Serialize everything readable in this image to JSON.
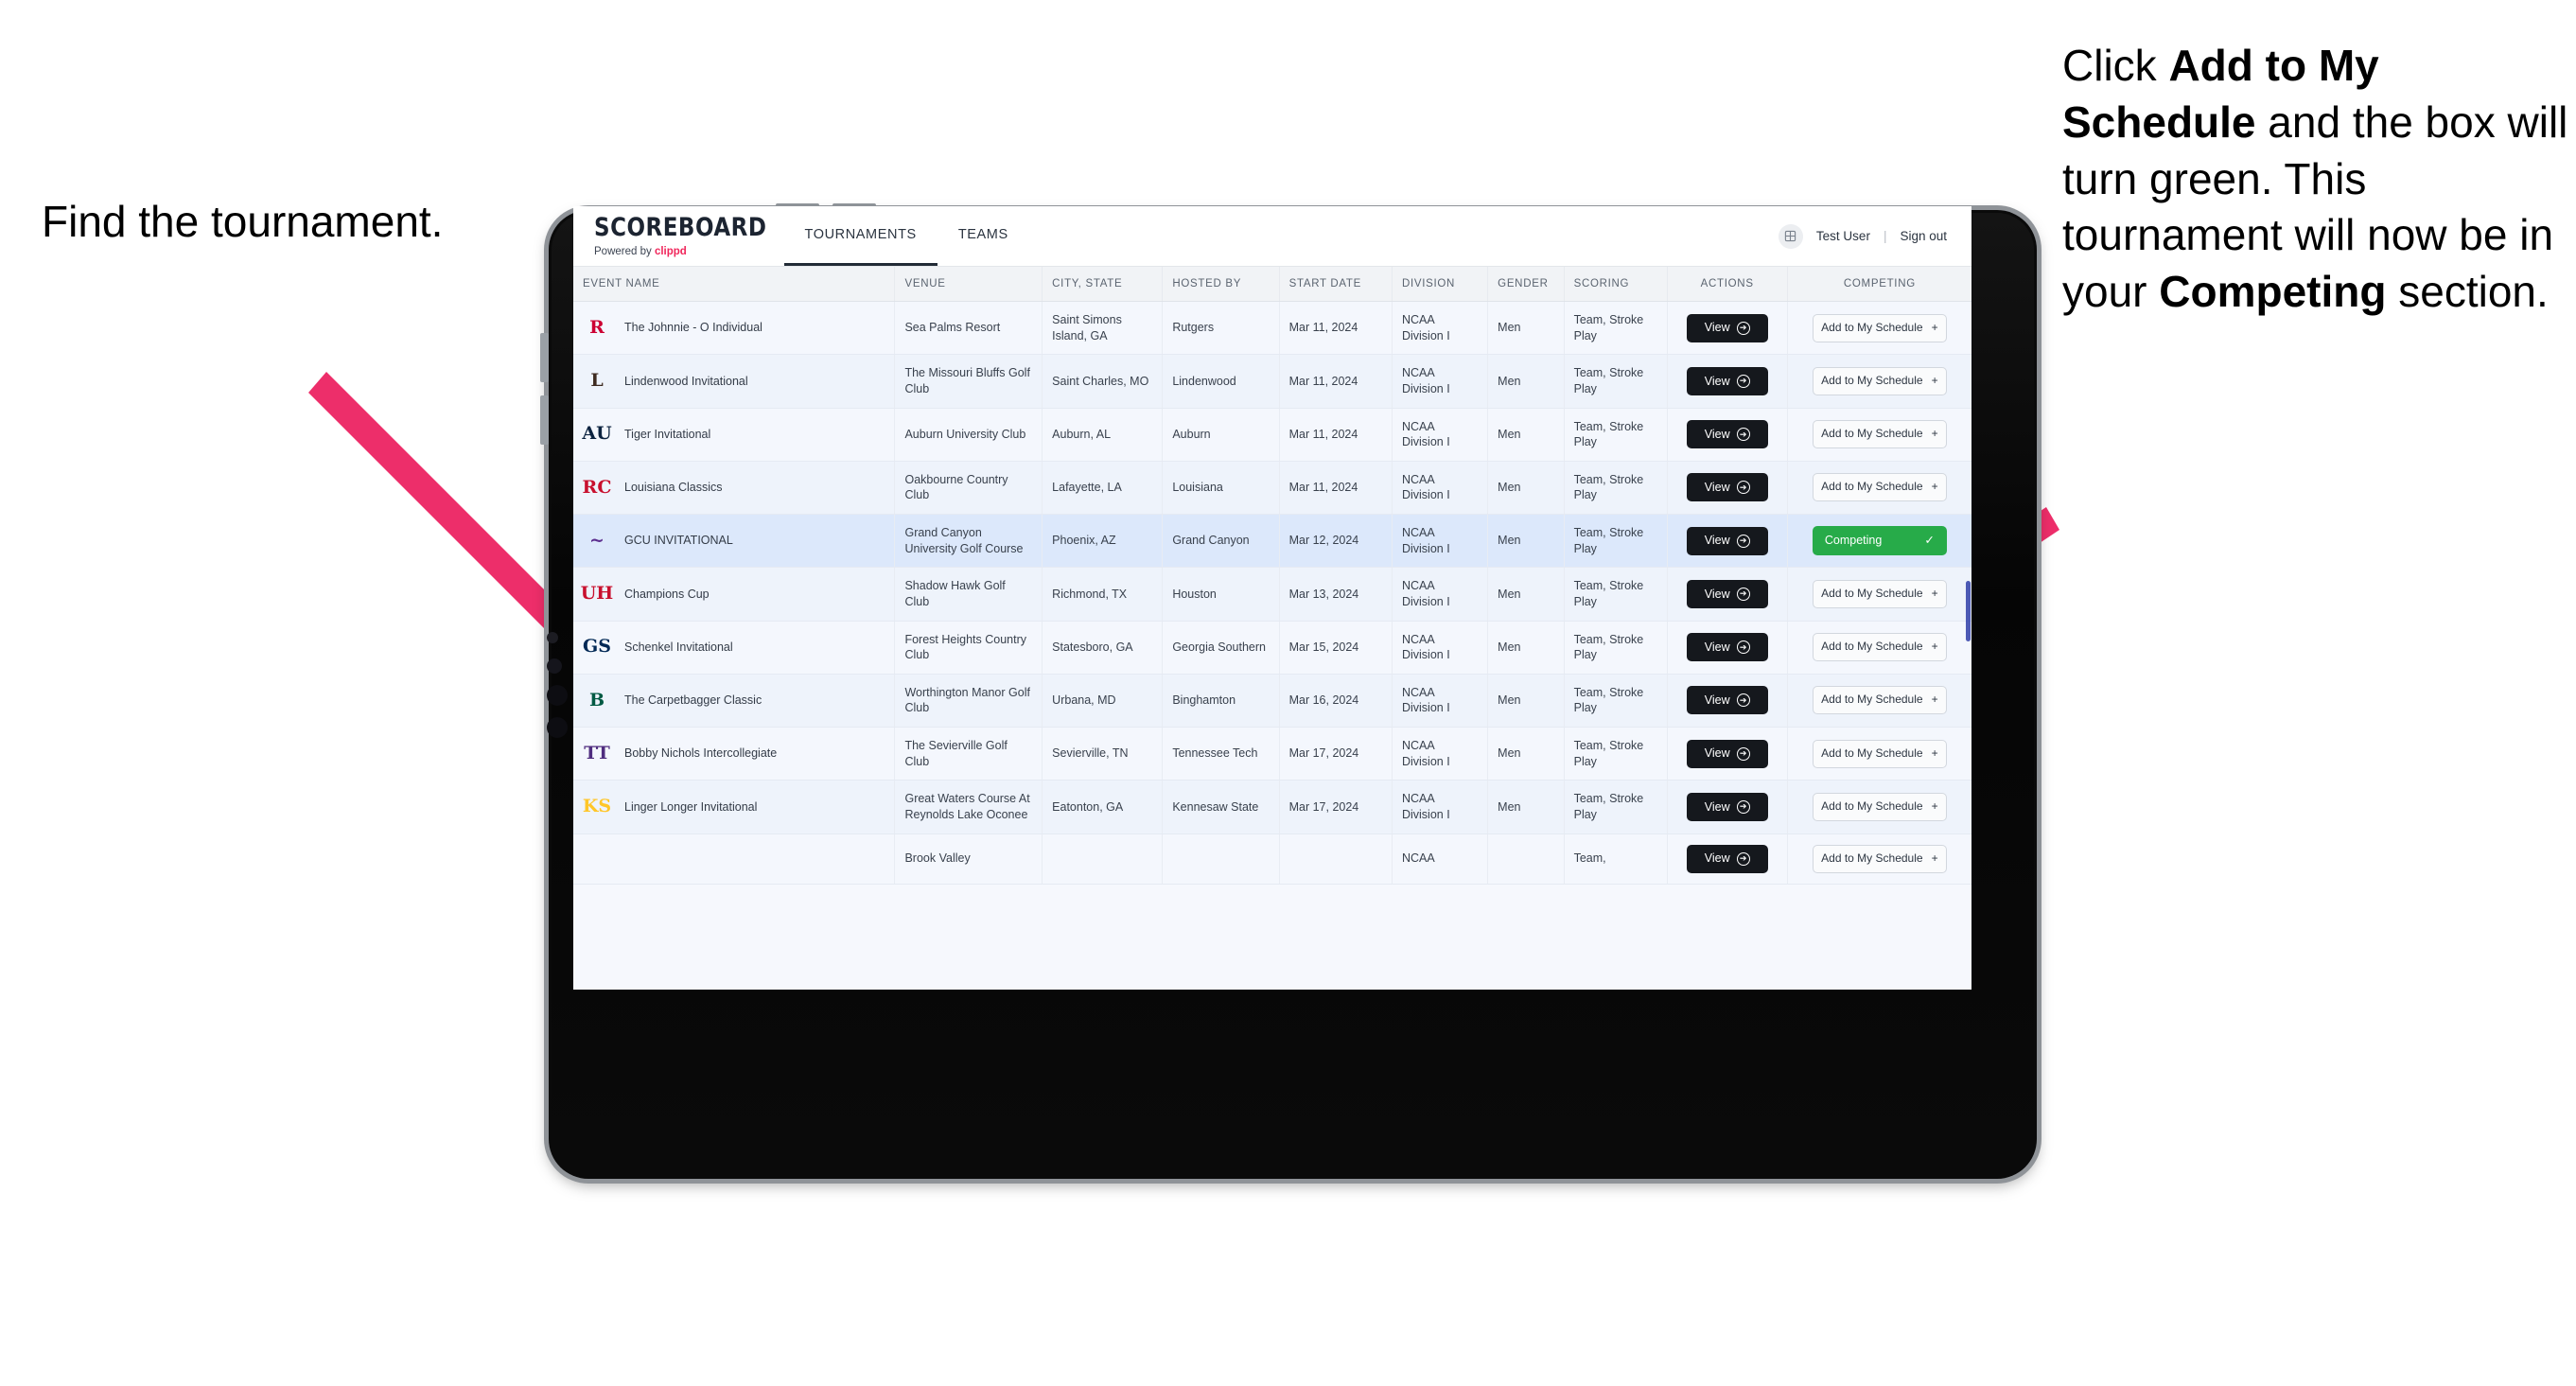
{
  "annotations": {
    "left": {
      "text": "Find the tournament."
    },
    "right": {
      "pre": "Click ",
      "bold1": "Add to My Schedule",
      "mid": " and the box will turn green. This tournament will now be in your ",
      "bold2": "Competing",
      "post": " section."
    },
    "arrow_color": "#ED2E6A"
  },
  "app": {
    "brand": {
      "name": "SCOREBOARD",
      "powered_prefix": "Powered by ",
      "powered_name": "clippd"
    },
    "tabs": [
      {
        "label": "TOURNAMENTS",
        "active": true
      },
      {
        "label": "TEAMS",
        "active": false
      }
    ],
    "account": {
      "avatar_icon": "grid-icon",
      "user": "Test User",
      "separator": "|",
      "signout": "Sign out"
    }
  },
  "table": {
    "columns": [
      "EVENT NAME",
      "VENUE",
      "CITY, STATE",
      "HOSTED BY",
      "START DATE",
      "DIVISION",
      "GENDER",
      "SCORING",
      "ACTIONS",
      "COMPETING"
    ],
    "action_label": "View",
    "add_label": "Add to My Schedule",
    "add_icon": "plus-icon",
    "competing_label": "Competing",
    "competing_icon": "check-icon",
    "competing_color": "#27AB49",
    "rows": [
      {
        "event": "The Johnnie - O Individual",
        "logo": "R",
        "logo_color": "#CC0033",
        "venue": "Sea Palms Resort",
        "city": "Saint Simons Island, GA",
        "host": "Rutgers",
        "date": "Mar 11, 2024",
        "division": "NCAA Division I",
        "gender": "Men",
        "scoring": "Team, Stroke Play",
        "competing": false
      },
      {
        "event": "Lindenwood Invitational",
        "logo": "L",
        "logo_color": "#3E2B20",
        "venue": "The Missouri Bluffs Golf Club",
        "city": "Saint Charles, MO",
        "host": "Lindenwood",
        "date": "Mar 11, 2024",
        "division": "NCAA Division I",
        "gender": "Men",
        "scoring": "Team, Stroke Play",
        "competing": false
      },
      {
        "event": "Tiger Invitational",
        "logo": "AU",
        "logo_color": "#0C2340",
        "venue": "Auburn University Club",
        "city": "Auburn, AL",
        "host": "Auburn",
        "date": "Mar 11, 2024",
        "division": "NCAA Division I",
        "gender": "Men",
        "scoring": "Team, Stroke Play",
        "competing": false
      },
      {
        "event": "Louisiana Classics",
        "logo": "RC",
        "logo_color": "#C8102E",
        "venue": "Oakbourne Country Club",
        "city": "Lafayette, LA",
        "host": "Louisiana",
        "date": "Mar 11, 2024",
        "division": "NCAA Division I",
        "gender": "Men",
        "scoring": "Team, Stroke Play",
        "competing": false
      },
      {
        "event": "GCU INVITATIONAL",
        "logo": "~",
        "logo_color": "#5B2D8E",
        "venue": "Grand Canyon University Golf Course",
        "city": "Phoenix, AZ",
        "host": "Grand Canyon",
        "date": "Mar 12, 2024",
        "division": "NCAA Division I",
        "gender": "Men",
        "scoring": "Team, Stroke Play",
        "competing": true
      },
      {
        "event": "Champions Cup",
        "logo": "UH",
        "logo_color": "#C8102E",
        "venue": "Shadow Hawk Golf Club",
        "city": "Richmond, TX",
        "host": "Houston",
        "date": "Mar 13, 2024",
        "division": "NCAA Division I",
        "gender": "Men",
        "scoring": "Team, Stroke Play",
        "competing": false
      },
      {
        "event": "Schenkel Invitational",
        "logo": "GS",
        "logo_color": "#002855",
        "venue": "Forest Heights Country Club",
        "city": "Statesboro, GA",
        "host": "Georgia Southern",
        "date": "Mar 15, 2024",
        "division": "NCAA Division I",
        "gender": "Men",
        "scoring": "Team, Stroke Play",
        "competing": false
      },
      {
        "event": "The Carpetbagger Classic",
        "logo": "B",
        "logo_color": "#005A43",
        "venue": "Worthington Manor Golf Club",
        "city": "Urbana, MD",
        "host": "Binghamton",
        "date": "Mar 16, 2024",
        "division": "NCAA Division I",
        "gender": "Men",
        "scoring": "Team, Stroke Play",
        "competing": false
      },
      {
        "event": "Bobby Nichols Intercollegiate",
        "logo": "TT",
        "logo_color": "#4F2D7F",
        "venue": "The Sevierville Golf Club",
        "city": "Sevierville, TN",
        "host": "Tennessee Tech",
        "date": "Mar 17, 2024",
        "division": "NCAA Division I",
        "gender": "Men",
        "scoring": "Team, Stroke Play",
        "competing": false
      },
      {
        "event": "Linger Longer Invitational",
        "logo": "KS",
        "logo_color": "#FFC629",
        "venue": "Great Waters Course At Reynolds Lake Oconee",
        "city": "Eatonton, GA",
        "host": "Kennesaw State",
        "date": "Mar 17, 2024",
        "division": "NCAA Division I",
        "gender": "Men",
        "scoring": "Team, Stroke Play",
        "competing": false
      },
      {
        "event": "",
        "logo": "",
        "logo_color": "#4F2D7F",
        "venue": "Brook Valley",
        "city": "",
        "host": "",
        "date": "",
        "division": "NCAA",
        "gender": "",
        "scoring": "Team,",
        "competing": false
      }
    ]
  }
}
